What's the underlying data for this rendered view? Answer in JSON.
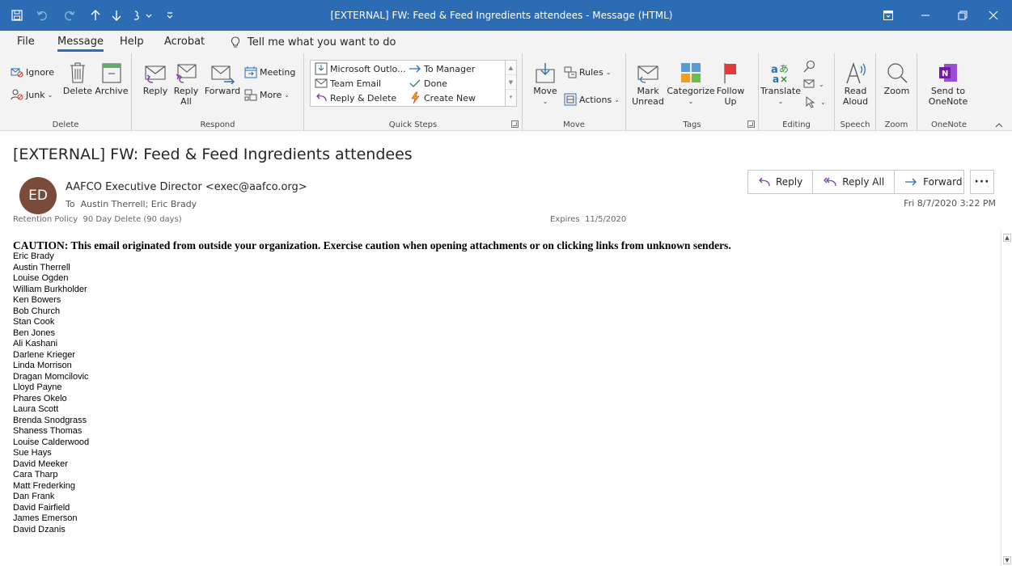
{
  "window": {
    "title": "[EXTERNAL] FW: Feed & Feed Ingredients attendees  -  Message (HTML)",
    "title_bar_color": "#2b6cb5"
  },
  "menu": {
    "tabs": [
      "File",
      "Message",
      "Help",
      "Acrobat"
    ],
    "active_tab": "Message",
    "tell_me": "Tell me what you want to do"
  },
  "ribbon": {
    "delete": {
      "ignore": "Ignore",
      "junk": "Junk",
      "delete_l1": "Delete",
      "archive": "Archive",
      "label": "Delete"
    },
    "respond": {
      "reply": "Reply",
      "reply_all_l1": "Reply",
      "reply_all_l2": "All",
      "forward": "Forward",
      "meeting": "Meeting",
      "more": "More",
      "label": "Respond"
    },
    "quick_steps": {
      "items": [
        "Microsoft Outlo...",
        "Team Email",
        "Reply & Delete",
        "To Manager",
        "Done",
        "Create New"
      ],
      "label": "Quick Steps"
    },
    "move": {
      "move": "Move",
      "rules": "Rules",
      "actions": "Actions",
      "label": "Move"
    },
    "tags": {
      "mark_l1": "Mark",
      "mark_l2": "Unread",
      "categorize": "Categorize",
      "follow_l1": "Follow",
      "follow_l2": "Up",
      "label": "Tags"
    },
    "editing": {
      "translate": "Translate",
      "label": "Editing"
    },
    "speech": {
      "read_l1": "Read",
      "read_l2": "Aloud",
      "label": "Speech"
    },
    "zoom": {
      "zoom": "Zoom",
      "label": "Zoom"
    },
    "onenote": {
      "send_l1": "Send to",
      "send_l2": "OneNote",
      "label": "OneNote"
    }
  },
  "message": {
    "subject": "[EXTERNAL] FW: Feed & Feed Ingredients attendees",
    "avatar_initials": "ED",
    "avatar_color": "#7a4a3a",
    "sender": "AAFCO Executive Director <exec@aafco.org>",
    "to_label": "To",
    "to": "Austin Therrell; Eric Brady",
    "retention_label": "Retention Policy",
    "retention": "90 Day Delete (90 days)",
    "expires_label": "Expires",
    "expires": "11/5/2020",
    "datetime": "Fri 8/7/2020 3:22 PM",
    "actions": {
      "reply": "Reply",
      "reply_all": "Reply All",
      "forward": "Forward"
    }
  },
  "body": {
    "caution": "CAUTION: This email originated from outside your organization. Exercise caution when opening attachments or on clicking links from unknown senders.",
    "names": [
      "Eric Brady",
      "Austin Therrell",
      "Louise Ogden",
      "William Burkholder",
      "Ken Bowers",
      "Bob Church",
      "Stan Cook",
      "Ben Jones",
      "Ali Kashani",
      "Darlene Krieger",
      "Linda Morrison",
      "Dragan Momcilovic",
      "Lloyd Payne",
      "Phares Okelo",
      "Laura Scott",
      "Brenda Snodgrass",
      "Shaness Thomas",
      "Louise Calderwood",
      "Sue Hays",
      "David Meeker",
      "Cara Tharp",
      "Matt Frederking",
      "Dan Frank",
      "David Fairfield",
      "James Emerson",
      "David Dzanis"
    ]
  }
}
